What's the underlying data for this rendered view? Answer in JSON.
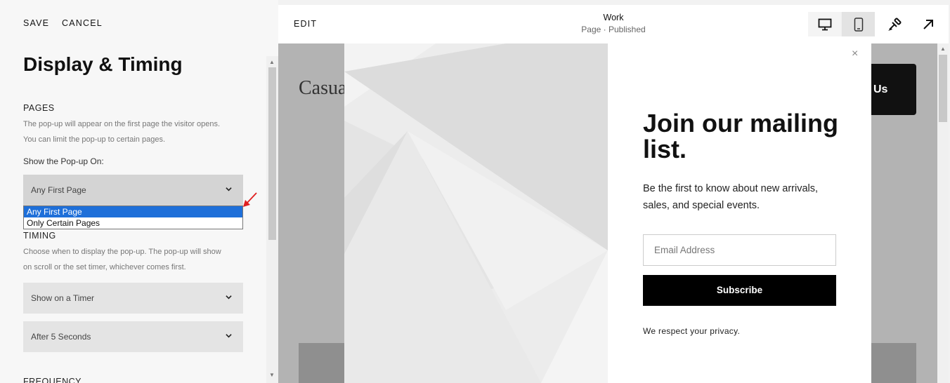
{
  "left_panel": {
    "save_label": "SAVE",
    "cancel_label": "CANCEL",
    "title": "Display & Timing",
    "pages": {
      "label": "PAGES",
      "desc_line1": "The pop-up will appear on the first page the visitor opens.",
      "desc_line2": "You can limit the pop-up to certain pages.",
      "field_label": "Show the Pop-up On:",
      "selected": "Any First Page",
      "options": [
        "Any First Page",
        "Only Certain Pages"
      ]
    },
    "timing": {
      "label": "TIMING",
      "desc_line1": "Choose when to display the pop-up. The pop-up will show",
      "desc_line2": "on scroll or the set timer, whichever comes first.",
      "trigger_value": "Show on a Timer",
      "delay_value": "After 5 Seconds"
    },
    "frequency": {
      "label": "FREQUENCY"
    }
  },
  "header": {
    "edit_label": "EDIT",
    "page_title": "Work",
    "page_status": "Page · Published"
  },
  "preview": {
    "site_logo": "Casua",
    "site_button": "Us",
    "popup": {
      "close": "×",
      "heading": "Join our mailing list.",
      "text": "Be the first to know about new arrivals, sales, and special events.",
      "email_placeholder": "Email Address",
      "subscribe_label": "Subscribe",
      "privacy": "We respect your privacy."
    }
  },
  "colors": {
    "selection_blue": "#1e6fd9",
    "annotation_red": "#e02020",
    "popup_button": "#000000"
  },
  "icons": {
    "desktop": "desktop-icon",
    "mobile": "mobile-icon",
    "style": "paintbrush-icon",
    "open": "external-link-icon",
    "chevron": "chevron-down-icon"
  }
}
